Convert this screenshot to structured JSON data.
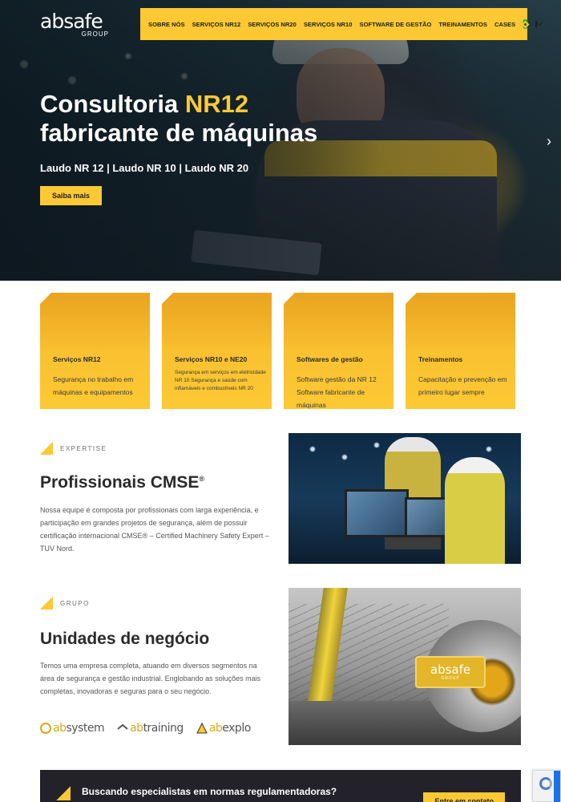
{
  "brand": {
    "logo_word": "absafe",
    "logo_sub": "GROUP",
    "accent": "#fcc934",
    "dark": "#23222b"
  },
  "nav": {
    "items": [
      "SOBRE NÓS",
      "SERVIÇOS NR12",
      "SERVIÇOS NR20",
      "SERVIÇOS NR10",
      "SOFTWARE DE GESTÃO",
      "TREINAMENTOS",
      "CASES"
    ],
    "flag_icon": "brazil-flag-icon",
    "mail_icon": "mail-icon"
  },
  "hero": {
    "title_part1": "Consultoria ",
    "title_highlight": "NR12",
    "title_line2": "fabricante de máquinas",
    "subtitle": "Laudo NR 12 | Laudo NR 10 | Laudo NR 20",
    "button": "Saiba mais",
    "next_arrow": "›"
  },
  "services": [
    {
      "title": "Serviços NR12",
      "desc": "Segurança no trabalho em máquinas e equipamentos"
    },
    {
      "title": "Serviços NR10 e NE20",
      "desc": "Segurança em serviços em eletricidade NR 10 Segurança e saúde com inflamáveis e combustíveis NR 20"
    },
    {
      "title": "Softwares de gestão",
      "desc": "Software gestão da NR 12 Software fabricante de máquinas"
    },
    {
      "title": "Treinamentos",
      "desc": "Capacitação e prevenção em primeiro lugar sempre"
    }
  ],
  "expertise": {
    "tag": "EXPERTISE",
    "title": "Profissionais CMSE",
    "title_sup": "®",
    "body": "Nossa equipe é composta por profissionais com larga experiência, e participação em grandes projetos de segurança, além de possuir certificação internacional CMSE® – Certified Machinery Safety Expert – TUV Nord."
  },
  "grupo": {
    "tag": "GRUPO",
    "title": "Unidades de negócio",
    "body": "Temos uma empresa completa, atuando em diversos segmentos na área de segurança e gestão industrial. Englobando as soluções mais completas, inovadoras e seguras para o seu negócio.",
    "badge_word": "absafe",
    "badge_sub": "GROUP",
    "units": [
      {
        "prefix": "ab",
        "name": "system"
      },
      {
        "prefix": "ab",
        "name": "training"
      },
      {
        "prefix": "ab",
        "name": "explo"
      }
    ]
  },
  "cta": {
    "text": "Buscando especialistas em normas regulamentadoras?",
    "button": "Entre em contato"
  }
}
